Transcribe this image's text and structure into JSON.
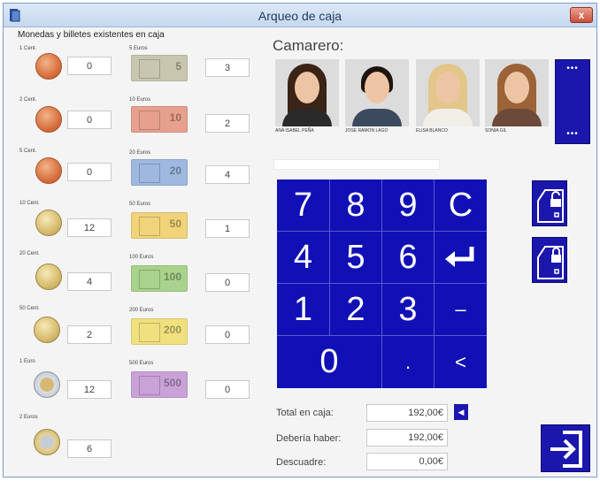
{
  "window": {
    "title": "Arqueo de caja",
    "close_label": "x"
  },
  "section_title": "Monedas y billetes existentes en caja",
  "coins": [
    {
      "label": "1 Cent.",
      "count": "0"
    },
    {
      "label": "2 Cent.",
      "count": "0"
    },
    {
      "label": "5 Cent.",
      "count": "0"
    },
    {
      "label": "10 Cent.",
      "count": "12"
    },
    {
      "label": "20 Cent.",
      "count": "4"
    },
    {
      "label": "50 Cent.",
      "count": "2"
    },
    {
      "label": "1 Euro",
      "count": "12"
    },
    {
      "label": "2 Euros",
      "count": "6"
    }
  ],
  "bills": [
    {
      "label": "5 Euros",
      "count": "3",
      "denomination": "5",
      "color": "#c9c6b0"
    },
    {
      "label": "10 Euros",
      "count": "2",
      "denomination": "10",
      "color": "#e7a08e"
    },
    {
      "label": "20 Euros",
      "count": "4",
      "denomination": "20",
      "color": "#9fb8df"
    },
    {
      "label": "50 Euros",
      "count": "1",
      "denomination": "50",
      "color": "#f1d37a"
    },
    {
      "label": "100 Euros",
      "count": "0",
      "denomination": "100",
      "color": "#a9d28c"
    },
    {
      "label": "200 Euros",
      "count": "0",
      "denomination": "200",
      "color": "#f0e07e"
    },
    {
      "label": "500 Euros",
      "count": "0",
      "denomination": "500",
      "color": "#c9a2d8"
    }
  ],
  "camarero_label": "Camarero:",
  "waiters": [
    {
      "name": "ANA ISABEL PEÑA",
      "hair_color": "#3a2416",
      "shirt_color": "#2a2a2a"
    },
    {
      "name": "JOSE RAMON LAGO",
      "hair_color": "#1e140d",
      "shirt_color": "#3b4a5e"
    },
    {
      "name": "ELISA BLANCO",
      "hair_color": "#e3c68a",
      "shirt_color": "#f2efe9"
    },
    {
      "name": "SONIA GIL",
      "hair_color": "#9b6337",
      "shirt_color": "#6b4a3a"
    }
  ],
  "more_waiters": {
    "dots_top": "•••",
    "dots_bottom": "•••"
  },
  "keypad": {
    "k7": "7",
    "k8": "8",
    "k9": "9",
    "clear": "C",
    "k4": "4",
    "k5": "5",
    "k6": "6",
    "k1": "1",
    "k2": "2",
    "k3": "3",
    "minus": "–",
    "k0": "0",
    "decimal": ".",
    "backspace": "<"
  },
  "totals": {
    "total_label": "Total en caja:",
    "total_value": "192,00€",
    "expected_label": "Debería haber:",
    "expected_value": "192,00€",
    "diff_label": "Descuadre:",
    "diff_value": "0,00€"
  },
  "accent_color": "#1b17ad"
}
